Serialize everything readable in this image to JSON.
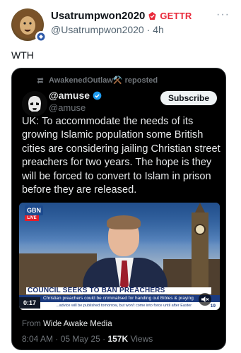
{
  "post": {
    "display_name": "Usatrumpwon2020",
    "badge_label": "GETTR",
    "handle": "@Usatrumpwon2020",
    "separator": " · ",
    "age": "4h",
    "text": "WTH",
    "more_icon": "more-horizontal-icon"
  },
  "quoted": {
    "reposted_by": "AwakenedOutlaw⚒️ reposted",
    "display_name": "@amuse",
    "handle": "@amuse",
    "subscribe_label": "Subscribe",
    "text": "UK: To accommodate the needs of its growing Islamic population some British cities are considering jailing Christian street preachers for two years. The hope is they will be forced to convert to Islam in prison before they are released.",
    "video": {
      "channel_logo": "GBN",
      "live_label": "LIVE",
      "headline": "COUNCIL SEEKS TO BAN PREACHERS",
      "ticker": "Christian preachers could be criminalised for handing out Bibles & praying",
      "ticker2": "...advice will be published tomorrow, but won't come into force until after Easter",
      "elapsed": "0:17",
      "clock": "19"
    },
    "source_prefix": "From ",
    "source_name": "Wide Awake Media",
    "time": "8:04 AM",
    "date_sep": " · ",
    "date": "05 May 25",
    "views_sep": " · ",
    "views": "157K",
    "views_label": " Views"
  },
  "colors": {
    "gettr_red": "#e9283a",
    "verified_blue": "#1d9bf0",
    "card_bg": "#000000"
  }
}
